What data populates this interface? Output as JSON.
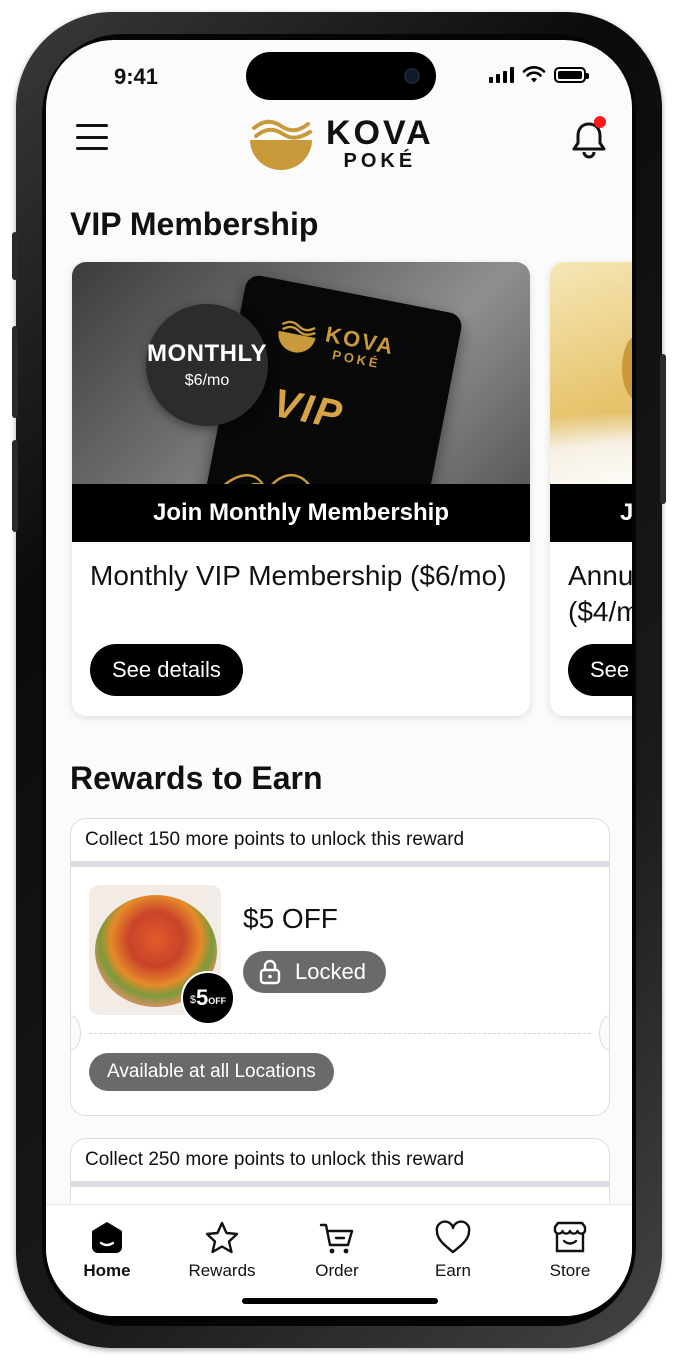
{
  "status_bar": {
    "time": "9:41"
  },
  "header": {
    "logo_line1": "KOVA",
    "logo_line2": "POKÉ",
    "notification_indicator": true
  },
  "vip": {
    "section_title": "VIP Membership",
    "cards": [
      {
        "badge_title": "MONTHLY",
        "badge_price": "$6/mo",
        "card_logo_line1": "KOVA",
        "card_logo_line2": "POKÉ",
        "card_vip": "VIP",
        "banner": "Join Monthly Membership",
        "name": "Monthly VIP Membership ($6/mo)",
        "button": "See details"
      },
      {
        "banner": "J",
        "name": "Annu ($4/m",
        "button": "See d"
      }
    ]
  },
  "rewards": {
    "section_title": "Rewards to Earn",
    "items": [
      {
        "header": "Collect 150 more points to unlock this reward",
        "badge_dollar": "$",
        "badge_amount": "5",
        "badge_off": "OFF",
        "title": "$5 OFF",
        "status": "Locked",
        "availability": "Available at all Locations"
      },
      {
        "header": "Collect 250 more points to unlock this reward"
      }
    ]
  },
  "tabbar": {
    "tabs": [
      {
        "label": "Home",
        "icon": "home-icon",
        "active": true
      },
      {
        "label": "Rewards",
        "icon": "star-icon",
        "active": false
      },
      {
        "label": "Order",
        "icon": "cart-icon",
        "active": false
      },
      {
        "label": "Earn",
        "icon": "heart-icon",
        "active": false
      },
      {
        "label": "Store",
        "icon": "store-icon",
        "active": false
      }
    ]
  },
  "colors": {
    "accent_gold": "#c89a3b",
    "pill_gray": "#6a6a6a",
    "notification_red": "#ff1a1a"
  }
}
